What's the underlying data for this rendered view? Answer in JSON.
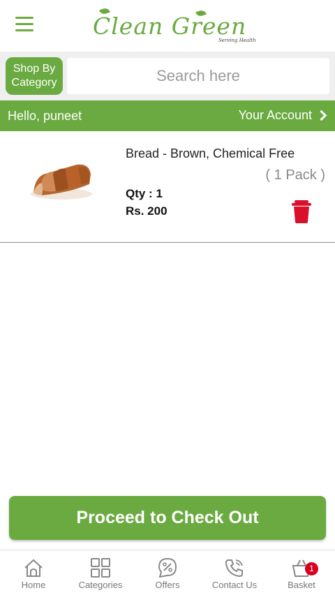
{
  "app": {
    "logo_text": "Clean Green",
    "logo_tagline": "Serving Health"
  },
  "search": {
    "category_button": "Shop By Category",
    "placeholder": "Search here"
  },
  "greeting": {
    "hello": "Hello, puneet",
    "account": "Your Account"
  },
  "cart": {
    "items": [
      {
        "name": "Bread - Brown, Chemical Free",
        "pack": "( 1 Pack )",
        "qty": "Qty : 1",
        "price": "Rs. 200",
        "image_icon": "bread-image",
        "delete_icon": "trash-icon"
      }
    ]
  },
  "checkout": {
    "label": "Proceed to Check Out"
  },
  "bottom_nav": {
    "items": [
      {
        "label": "Home",
        "icon": "home-icon"
      },
      {
        "label": "Categories",
        "icon": "grid-icon"
      },
      {
        "label": "Offers",
        "icon": "offer-icon"
      },
      {
        "label": "Contact Us",
        "icon": "phone-icon"
      },
      {
        "label": "Basket",
        "icon": "basket-icon",
        "badge": "1"
      }
    ]
  },
  "colors": {
    "brand_green": "#6aaa40",
    "delete_red": "#d8102c",
    "badge_red": "#d8001f"
  }
}
